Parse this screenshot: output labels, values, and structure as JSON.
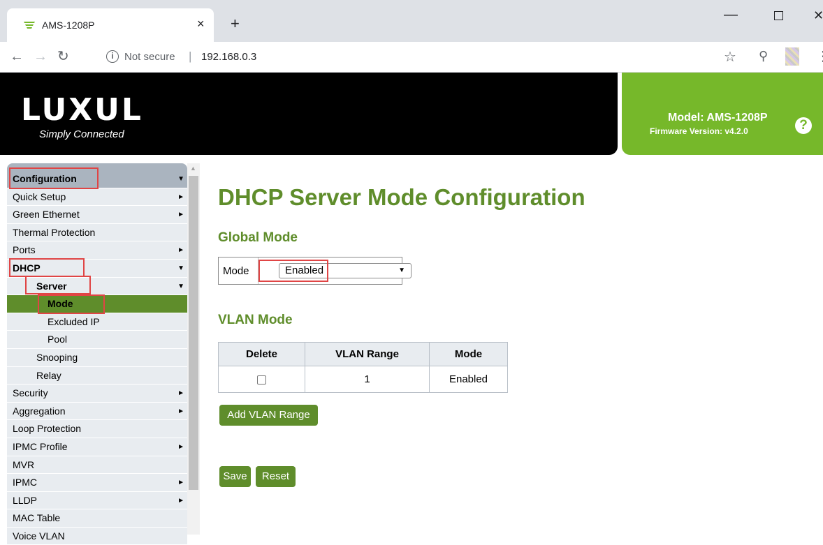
{
  "browser": {
    "tab_title": "AMS-1208P",
    "tab_close": "×",
    "new_tab": "+",
    "security_label": "Not secure",
    "url_separator": "|",
    "url": "192.168.0.3",
    "icons": [
      "luxul-favicon",
      "back-arrow-icon",
      "forward-arrow-icon",
      "reload-icon",
      "info-icon",
      "star-icon",
      "key-icon",
      "extension-icon",
      "menu-icon",
      "minimize-icon",
      "maximize-icon",
      "close-icon"
    ]
  },
  "header": {
    "logo": "LUXUL",
    "tagline": "Simply Connected",
    "model": "Model: AMS-1208P",
    "firmware": "Firmware Version: v4.2.0",
    "help_icon": "?",
    "brand_green": "#76b82a",
    "dark_green": "#5f8d2b"
  },
  "sidebar": {
    "items": [
      {
        "label": "Configuration",
        "arrow": "▼"
      },
      {
        "label": "Quick Setup",
        "arrow": "►"
      },
      {
        "label": "Green Ethernet",
        "arrow": "►"
      },
      {
        "label": "Thermal Protection",
        "arrow": ""
      },
      {
        "label": "Ports",
        "arrow": "►"
      },
      {
        "label": "DHCP",
        "arrow": "▼"
      },
      {
        "label": "Server",
        "arrow": "▼"
      },
      {
        "label": "Mode",
        "arrow": ""
      },
      {
        "label": "Excluded IP",
        "arrow": ""
      },
      {
        "label": "Pool",
        "arrow": ""
      },
      {
        "label": "Snooping",
        "arrow": ""
      },
      {
        "label": "Relay",
        "arrow": ""
      },
      {
        "label": "Security",
        "arrow": "►"
      },
      {
        "label": "Aggregation",
        "arrow": "►"
      },
      {
        "label": "Loop Protection",
        "arrow": ""
      },
      {
        "label": "IPMC Profile",
        "arrow": "►"
      },
      {
        "label": "MVR",
        "arrow": ""
      },
      {
        "label": "IPMC",
        "arrow": "►"
      },
      {
        "label": "LLDP",
        "arrow": "►"
      },
      {
        "label": "MAC Table",
        "arrow": ""
      },
      {
        "label": "Voice VLAN",
        "arrow": ""
      }
    ],
    "active_item": "Mode"
  },
  "main": {
    "title": "DHCP Server Mode Configuration",
    "global_mode": {
      "heading": "Global Mode",
      "label": "Mode",
      "selected": "Enabled"
    },
    "vlan_mode": {
      "heading": "VLAN Mode",
      "columns": [
        "Delete",
        "VLAN Range",
        "Mode"
      ],
      "rows": [
        {
          "delete_checked": false,
          "range": "1",
          "mode": "Enabled"
        }
      ]
    },
    "add_vlan_button": "Add VLAN Range",
    "save_button": "Save",
    "reset_button": "Reset"
  }
}
